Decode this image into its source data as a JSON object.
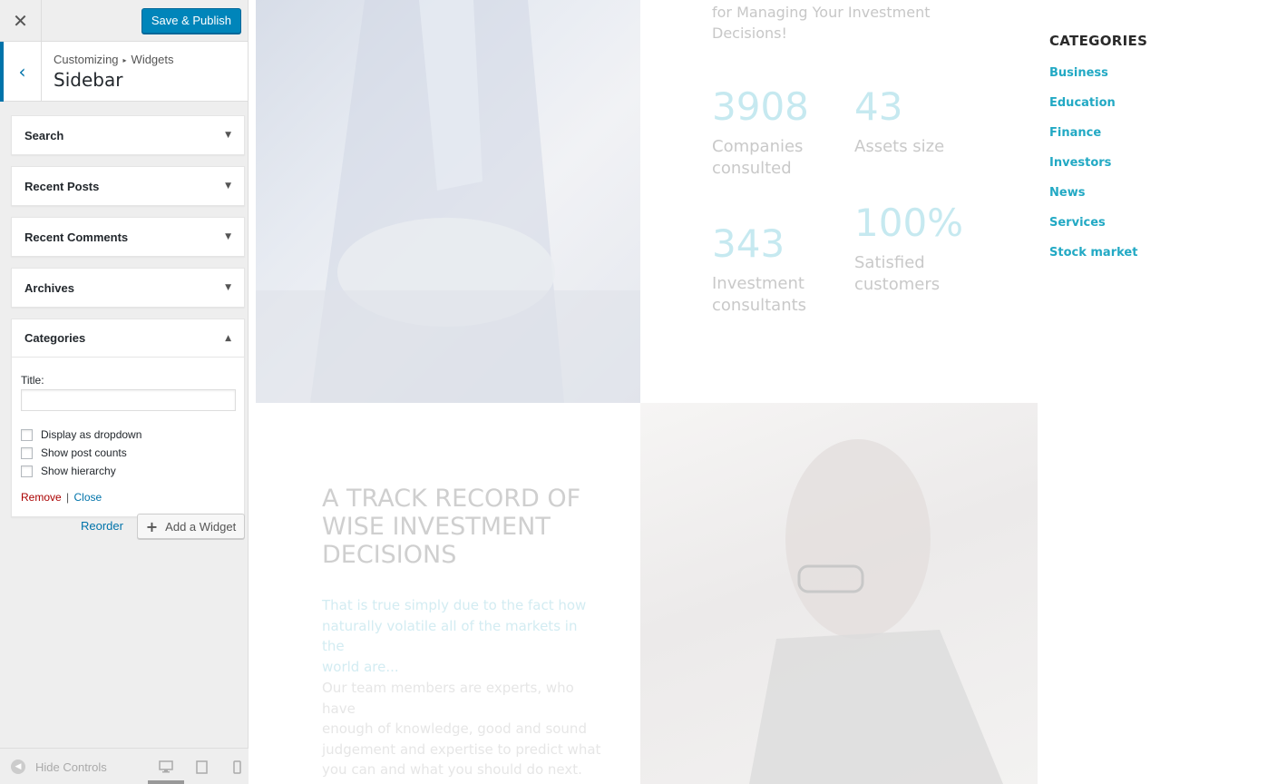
{
  "customizer": {
    "close_glyph": "✕",
    "save_label": "Save & Publish",
    "breadcrumb": {
      "root": "Customizing",
      "separator": "▸",
      "section": "Widgets"
    },
    "panel_title": "Sidebar",
    "back_glyph": "‹",
    "widgets": [
      {
        "label": "Search",
        "open": false
      },
      {
        "label": "Recent Posts",
        "open": false
      },
      {
        "label": "Recent Comments",
        "open": false
      },
      {
        "label": "Archives",
        "open": false
      },
      {
        "label": "Categories",
        "open": true
      }
    ],
    "arrow_down": "▼",
    "arrow_up": "▲",
    "categories_widget": {
      "title_label": "Title:",
      "title_value": "",
      "options": [
        {
          "label": "Display as dropdown",
          "checked": false
        },
        {
          "label": "Show post counts",
          "checked": false
        },
        {
          "label": "Show hierarchy",
          "checked": false
        }
      ],
      "remove_label": "Remove",
      "pipe": "|",
      "close_label": "Close"
    },
    "reorder_label": "Reorder",
    "add_widget_label": "Add a Widget",
    "add_widget_glyph": "+",
    "hide_controls_label": "Hide Controls",
    "hide_controls_glyph": "◀",
    "active_device": "desktop"
  },
  "preview": {
    "intro_lines": [
      "for Managing Your Investment",
      "Decisions!"
    ],
    "stats": [
      {
        "value": "3908",
        "label_lines": [
          "Companies",
          "consulted"
        ]
      },
      {
        "value": "43",
        "label_lines": [
          "Assets size"
        ]
      },
      {
        "value": "343",
        "label_lines": [
          "Investment",
          "consultants"
        ]
      },
      {
        "value": "100%",
        "label_lines": [
          "Satisfied",
          "customers"
        ]
      }
    ],
    "track_title_lines": [
      "A TRACK RECORD OF",
      "WISE INVESTMENT",
      "DECISIONS"
    ],
    "track_lead_lines": [
      "That is true simply due to the fact how",
      "naturally volatile all of the markets in the",
      "world are..."
    ],
    "track_body_lines": [
      "Our team members are experts, who have",
      "enough of knowledge, good and sound",
      "judgement and expertise to predict what",
      "you can and what you should do next."
    ],
    "categories_title": "CATEGORIES",
    "categories": [
      "Business",
      "Education",
      "Finance",
      "Investors",
      "News",
      "Services",
      "Stock market"
    ]
  },
  "colors": {
    "primary_button": "#0085ba",
    "link": "#0073aa",
    "remove": "#aa0000",
    "category_link": "#22a9c4"
  }
}
